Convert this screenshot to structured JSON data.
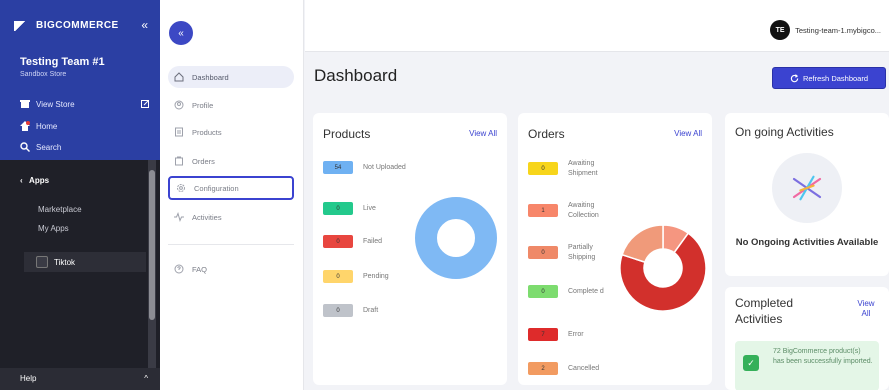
{
  "bc_rail": {
    "logo": "BIGCOMMERCE",
    "collapse_icon": "«",
    "store_name": "Testing Team #1",
    "store_sub": "Sandbox Store",
    "nav": [
      {
        "label": "View Store",
        "icon": "storefront-icon"
      },
      {
        "label": "Home",
        "icon": "home-icon"
      },
      {
        "label": "Search",
        "icon": "search-icon"
      }
    ],
    "apps_heading": "Apps",
    "apps_caret": "‹",
    "apps_sub": [
      "Marketplace",
      "My Apps"
    ],
    "active_app": "Tiktok",
    "help": "Help",
    "help_caret": "^"
  },
  "sidebar": {
    "collapse_icon": "«",
    "items": [
      {
        "label": "Dashboard",
        "icon": "home-icon"
      },
      {
        "label": "Profile",
        "icon": "profile-icon"
      },
      {
        "label": "Products",
        "icon": "products-icon"
      },
      {
        "label": "Orders",
        "icon": "orders-icon"
      },
      {
        "label": "Configuration",
        "icon": "gear-icon"
      },
      {
        "label": "Activities",
        "icon": "activity-icon"
      },
      {
        "label": "FAQ",
        "icon": "help-icon"
      }
    ]
  },
  "header": {
    "avatar": "TE",
    "user": "Testing-team-1.mybigco..."
  },
  "main": {
    "title": "Dashboard",
    "refresh_label": "Refresh Dashboard"
  },
  "products": {
    "title": "Products",
    "view_all": "View All",
    "stats": [
      {
        "value": "54",
        "label": "Not Uploaded",
        "color": "#6fb1f2"
      },
      {
        "value": "0",
        "label": "Live",
        "color": "#23c98c"
      },
      {
        "value": "0",
        "label": "Failed",
        "color": "#e8463f"
      },
      {
        "value": "0",
        "label": "Pending",
        "color": "#ffd56b"
      },
      {
        "value": "0",
        "label": "Draft",
        "color": "#bfc3ca"
      }
    ]
  },
  "orders": {
    "title": "Orders",
    "view_all": "View All",
    "stats": [
      {
        "value": "0",
        "label": "Awaiting Shipment",
        "color": "#f7d51b"
      },
      {
        "value": "1",
        "label": "Awaiting Collection",
        "color": "#f7866a"
      },
      {
        "value": "0",
        "label": "Partially Shipping",
        "color": "#ef8968"
      },
      {
        "value": "0",
        "label": "Complete d",
        "color": "#7ddc6f"
      },
      {
        "value": "7",
        "label": "Error",
        "color": "#de2b2b"
      },
      {
        "value": "2",
        "label": "Cancelled",
        "color": "#f29b61"
      }
    ]
  },
  "ongoing": {
    "title": "On going Activities",
    "message": "No Ongoing Activities Available"
  },
  "completed": {
    "title": "Completed Activities",
    "view_all": "View All",
    "item": "72 BigCommerce product(s) has been successfully imported."
  },
  "chart_data": [
    {
      "type": "pie",
      "labels": [
        "Not Uploaded"
      ],
      "values": [
        54
      ],
      "colors": [
        "#7fb9f4"
      ]
    },
    {
      "type": "pie",
      "labels": [
        "Awaiting Collection",
        "Error",
        "Cancelled"
      ],
      "values": [
        1,
        7,
        2
      ],
      "colors": [
        "#f59680",
        "#d2302c",
        "#f09a7a"
      ]
    }
  ]
}
